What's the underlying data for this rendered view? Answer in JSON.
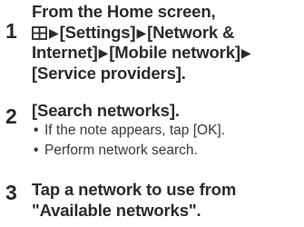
{
  "steps": [
    {
      "number": "1",
      "line1": "From the Home screen,",
      "line2_a": "[Settings]",
      "line2_b": "[Network &",
      "line3_a": "Internet]",
      "line3_b": "[Mobile network]",
      "line4": "[Service providers].",
      "icon": "apps-grid-icon",
      "separator_icon": "triangle-right-icon"
    },
    {
      "number": "2",
      "title": "[Search networks].",
      "notes": [
        "If the note appears, tap [OK].",
        "Perform network search."
      ],
      "bullet": "•"
    },
    {
      "number": "3",
      "line1": "Tap a network to use from",
      "line2": "\"Available networks\"."
    }
  ],
  "separator": "▶",
  "colors": {
    "text": "#2b2b2b",
    "note_text": "#3a3a3a",
    "background": "#ffffff"
  }
}
